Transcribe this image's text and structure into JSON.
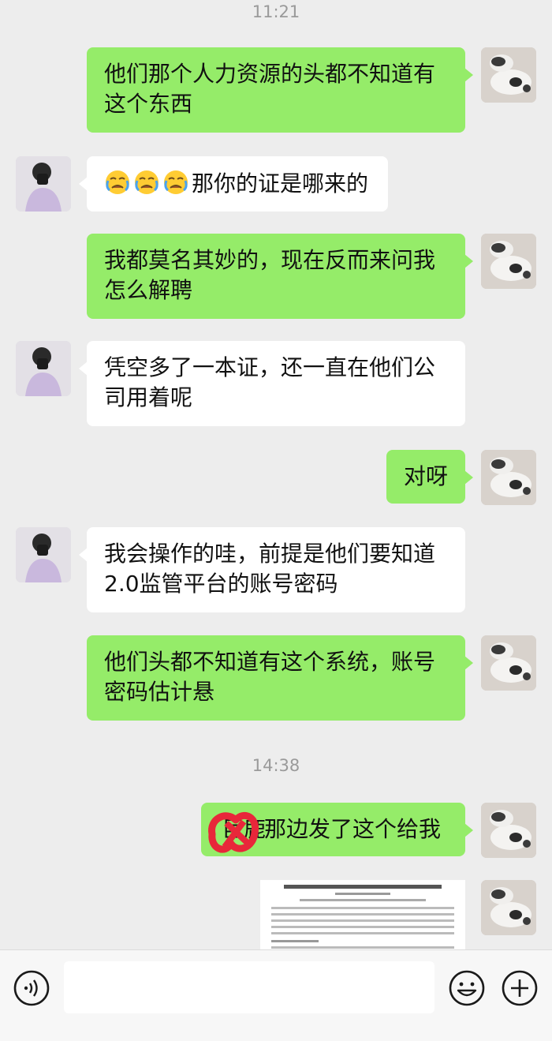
{
  "times": [
    "11:21",
    "14:38"
  ],
  "messages": [
    {
      "side": "out",
      "text": "他们那个人力资源的头都不知道有这个东西"
    },
    {
      "side": "in",
      "emoji": [
        "😭",
        "😭",
        "😭"
      ],
      "text": "那你的证是哪来的"
    },
    {
      "side": "out",
      "text": "我都莫名其妙的，现在反而来问我怎么解聘"
    },
    {
      "side": "in",
      "text": "凭空多了一本证，还一直在他们公司用着呢"
    },
    {
      "side": "out",
      "text": "对呀"
    },
    {
      "side": "in",
      "text": "我会操作的哇，前提是他们要知道2.0监管平台的账号密码"
    },
    {
      "side": "out",
      "text": "他们头都不知道有这个系统，账号密码估计悬"
    },
    {
      "side": "out",
      "text": "那边发了这个给我",
      "redacted_prefix": "巨鹿"
    },
    {
      "side": "out",
      "type": "image-document"
    }
  ],
  "input": {
    "placeholder": ""
  },
  "icons": {
    "voice": "voice-icon",
    "emoji": "emoji-icon",
    "plus": "plus-icon"
  },
  "colors": {
    "outgoing_bubble": "#95ec69",
    "incoming_bubble": "#ffffff",
    "background": "#ededed"
  }
}
